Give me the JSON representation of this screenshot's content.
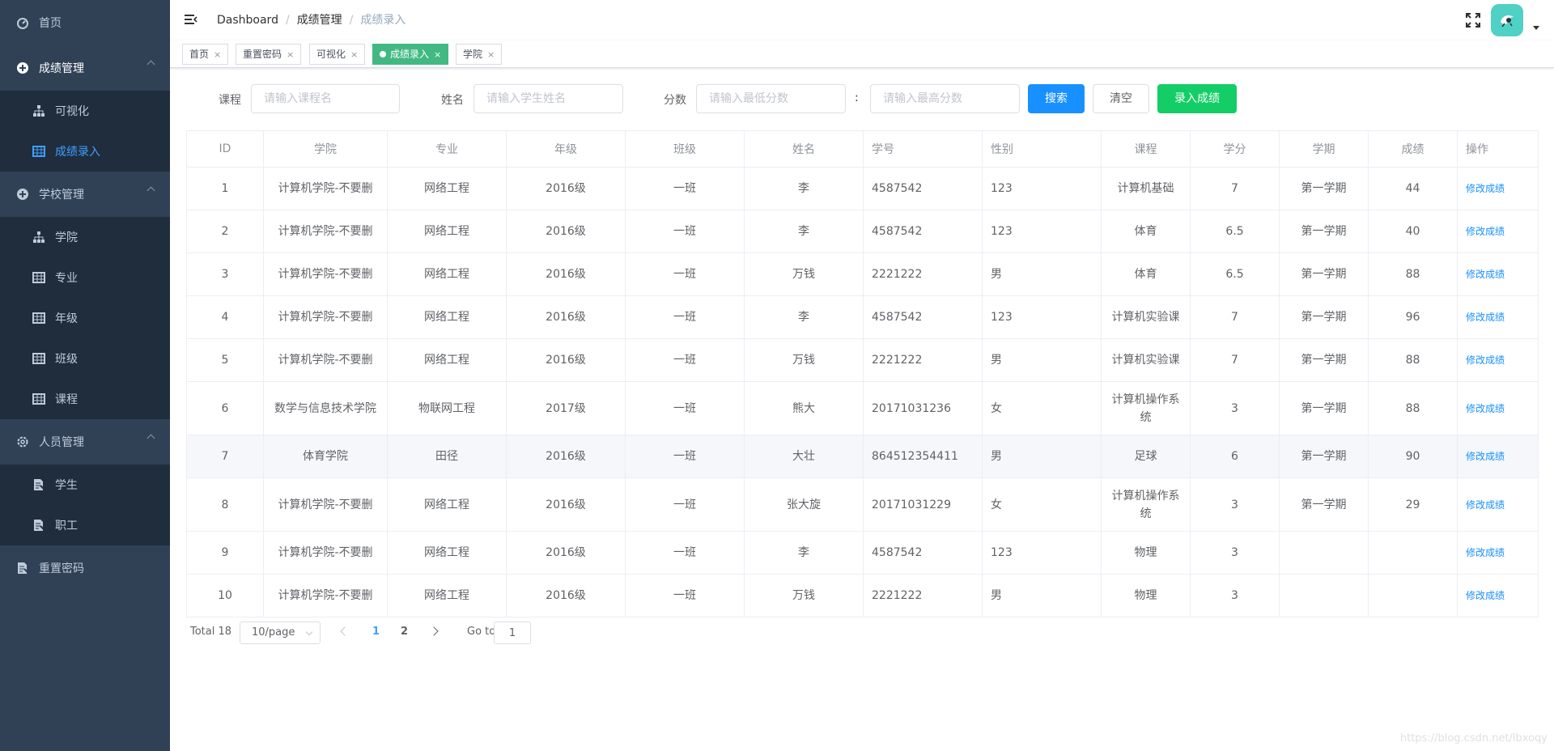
{
  "sidebar": {
    "home": "首页",
    "groups": [
      {
        "title": "成绩管理",
        "items": [
          "可视化",
          "成绩录入"
        ]
      },
      {
        "title": "学校管理",
        "items": [
          "学院",
          "专业",
          "年级",
          "班级",
          "课程"
        ]
      },
      {
        "title": "人员管理",
        "items": [
          "学生",
          "职工"
        ]
      }
    ],
    "reset_password": "重置密码"
  },
  "breadcrumb": [
    "Dashboard",
    "成绩管理",
    "成绩录入"
  ],
  "tags": [
    {
      "label": "首页",
      "close": "×"
    },
    {
      "label": "重置密码",
      "close": "×"
    },
    {
      "label": "可视化",
      "close": "×"
    },
    {
      "label": "成绩录入",
      "close": "×"
    },
    {
      "label": "学院",
      "close": "×"
    }
  ],
  "filter": {
    "course_label": "课程",
    "course_placeholder": "请输入课程名",
    "name_label": "姓名",
    "name_placeholder": "请输入学生姓名",
    "score_label": "分数",
    "min_placeholder": "请输入最低分数",
    "colon": ":",
    "max_placeholder": "请输入最高分数",
    "search": "搜索",
    "clear": "清空",
    "add": "录入成绩"
  },
  "table": {
    "headers": [
      "ID",
      "学院",
      "专业",
      "年级",
      "班级",
      "姓名",
      "学号",
      "性别",
      "课程",
      "学分",
      "学期",
      "成绩",
      "操作"
    ],
    "rows": [
      [
        "1",
        "计算机学院-不要删",
        "网络工程",
        "2016级",
        "一班",
        "李",
        "4587542",
        "123",
        "计算机基础",
        "7",
        "第一学期",
        "44",
        "修改成绩"
      ],
      [
        "2",
        "计算机学院-不要删",
        "网络工程",
        "2016级",
        "一班",
        "李",
        "4587542",
        "123",
        "体育",
        "6.5",
        "第一学期",
        "40",
        "修改成绩"
      ],
      [
        "3",
        "计算机学院-不要删",
        "网络工程",
        "2016级",
        "一班",
        "万钱",
        "2221222",
        "男",
        "体育",
        "6.5",
        "第一学期",
        "88",
        "修改成绩"
      ],
      [
        "4",
        "计算机学院-不要删",
        "网络工程",
        "2016级",
        "一班",
        "李",
        "4587542",
        "123",
        "计算机实验课",
        "7",
        "第一学期",
        "96",
        "修改成绩"
      ],
      [
        "5",
        "计算机学院-不要删",
        "网络工程",
        "2016级",
        "一班",
        "万钱",
        "2221222",
        "男",
        "计算机实验课",
        "7",
        "第一学期",
        "88",
        "修改成绩"
      ],
      [
        "6",
        "数学与信息技术学院",
        "物联网工程",
        "2017级",
        "一班",
        "熊大",
        "20171031236",
        "女",
        "计算机操作系统",
        "3",
        "第一学期",
        "88",
        "修改成绩"
      ],
      [
        "7",
        "体育学院",
        "田径",
        "2016级",
        "一班",
        "大壮",
        "864512354411",
        "男",
        "足球",
        "6",
        "第一学期",
        "90",
        "修改成绩"
      ],
      [
        "8",
        "计算机学院-不要删",
        "网络工程",
        "2016级",
        "一班",
        "张大旋",
        "20171031229",
        "女",
        "计算机操作系统",
        "3",
        "第一学期",
        "29",
        "修改成绩"
      ],
      [
        "9",
        "计算机学院-不要删",
        "网络工程",
        "2016级",
        "一班",
        "李",
        "4587542",
        "123",
        "物理",
        "3",
        "",
        "",
        "修改成绩"
      ],
      [
        "10",
        "计算机学院-不要删",
        "网络工程",
        "2016级",
        "一班",
        "万钱",
        "2221222",
        "男",
        "物理",
        "3",
        "",
        "",
        "修改成绩"
      ]
    ]
  },
  "pagination": {
    "total": "Total 18",
    "page_size": "10/page",
    "pages": [
      "1",
      "2"
    ],
    "current": "1",
    "goto_label": "Go to",
    "goto_value": "1"
  },
  "watermark": "https://blog.csdn.net/lbxoqy",
  "colors": {
    "sidebar": "#304156",
    "submenu": "#1f2d3d",
    "active": "#409eff",
    "tag_active": "#42b983",
    "primary": "#1890ff",
    "success": "#13ce66"
  }
}
